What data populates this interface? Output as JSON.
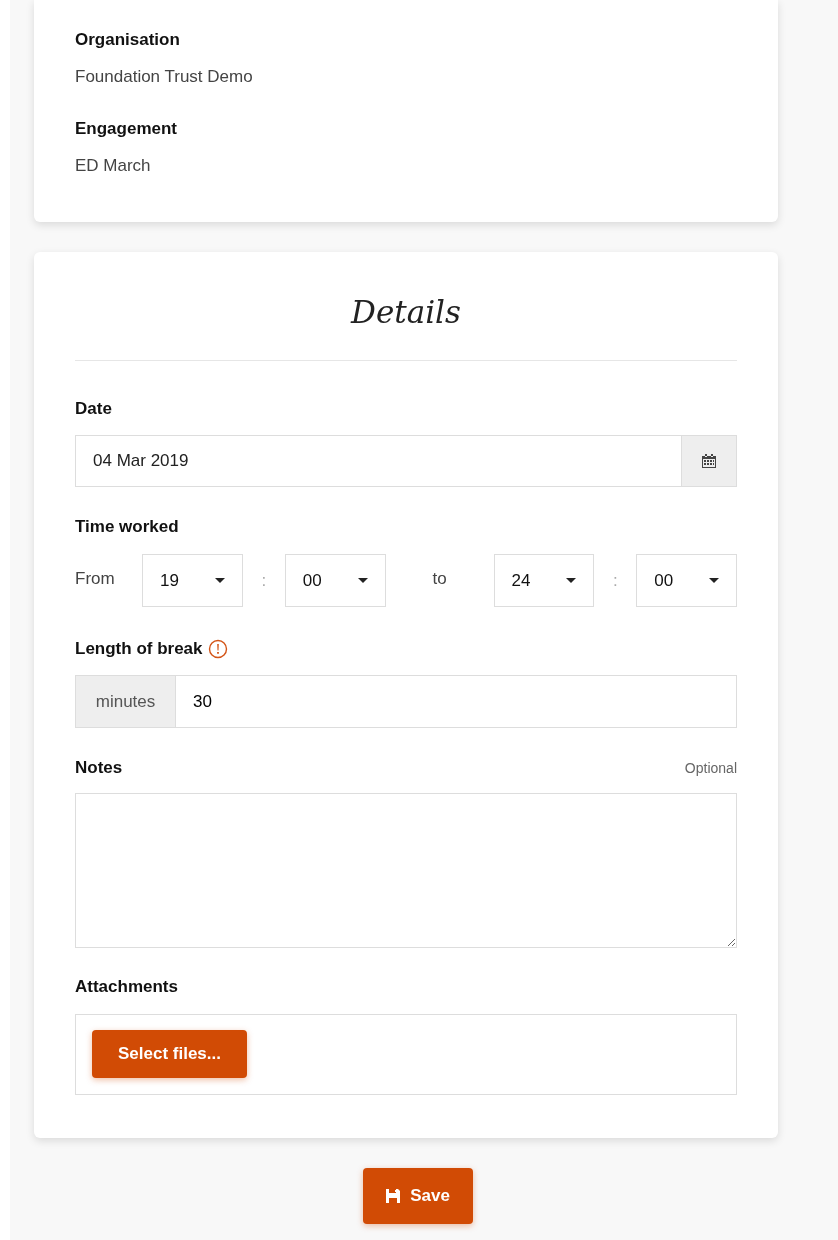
{
  "info": [
    {
      "label": "Organisation",
      "value": "Foundation Trust Demo"
    },
    {
      "label": "Engagement",
      "value": "ED March"
    }
  ],
  "details": {
    "title": "Details",
    "date": {
      "label": "Date",
      "value": "04 Mar 2019"
    },
    "time": {
      "label": "Time worked",
      "parts": [
        {
          "kind": "text",
          "text": "From"
        },
        {
          "kind": "select",
          "value": "19"
        },
        {
          "kind": "sep",
          "text": ":"
        },
        {
          "kind": "select",
          "value": "00"
        },
        {
          "kind": "text",
          "text": "to"
        },
        {
          "kind": "select",
          "value": "24"
        },
        {
          "kind": "sep",
          "text": ":"
        },
        {
          "kind": "select",
          "value": "00"
        }
      ]
    },
    "break": {
      "label": "Length of break",
      "addon": "minutes",
      "value": "30"
    },
    "notes": {
      "label": "Notes",
      "hint": "Optional"
    },
    "attachments": {
      "label": "Attachments",
      "button": "Select files..."
    }
  },
  "save": "Save"
}
